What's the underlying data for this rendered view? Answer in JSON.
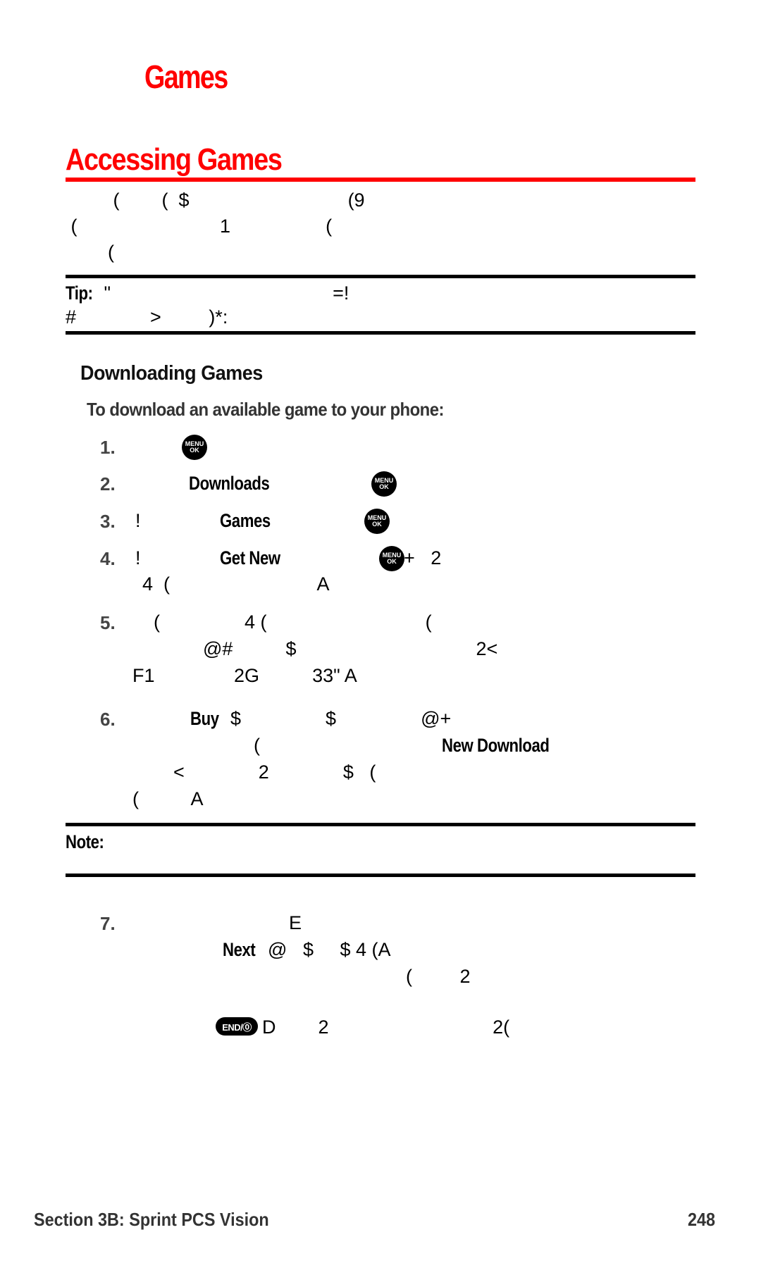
{
  "page": {
    "chapter_title": "Games",
    "section_heading": "Accessing Games",
    "intro_lines": [
      "         (        (  $                              (9",
      " (                           1                  (",
      "        ("
    ],
    "tip": {
      "label": "Tip:",
      "line1_rest": " \"                                          =!",
      "line2": "#              >         )*:"
    },
    "subheading": "Downloading Games",
    "procedure_intro": "To download an available game to your phone:",
    "steps": [
      {
        "number": "1.",
        "segments": []
      },
      {
        "number": "2.",
        "bold": "Downloads"
      },
      {
        "number": "3.",
        "prefix": "!",
        "bold": "Games"
      },
      {
        "number": "4.",
        "prefix": "!",
        "bold": "Get New",
        "after_key": "+   2",
        "line2": "4  (                            A"
      },
      {
        "number": "5.",
        "line1": "(                4 (                              (",
        "line2": "@#          $                                  2<",
        "line3": "F1               2G          33\" A"
      },
      {
        "number": "6.",
        "bold": "Buy",
        "line1_rest": " $                $                @+",
        "line2": "(",
        "line2_bold": "New Download",
        "line3": "<              2              $   (",
        "line4": "(          A"
      },
      {
        "number": "7.",
        "line1": "E",
        "bold": "Next",
        "line2_rest": " @   $     $ 4 (A",
        "line3": "(         2",
        "line5": "D        2                               2("
      }
    ],
    "note": {
      "label": "Note:"
    },
    "keys": {
      "menu_top": "MENU",
      "menu_bottom": "OK",
      "end": "END/⓪"
    },
    "footer": {
      "section": "Section 3B: Sprint PCS Vision",
      "page_number": "248"
    }
  }
}
